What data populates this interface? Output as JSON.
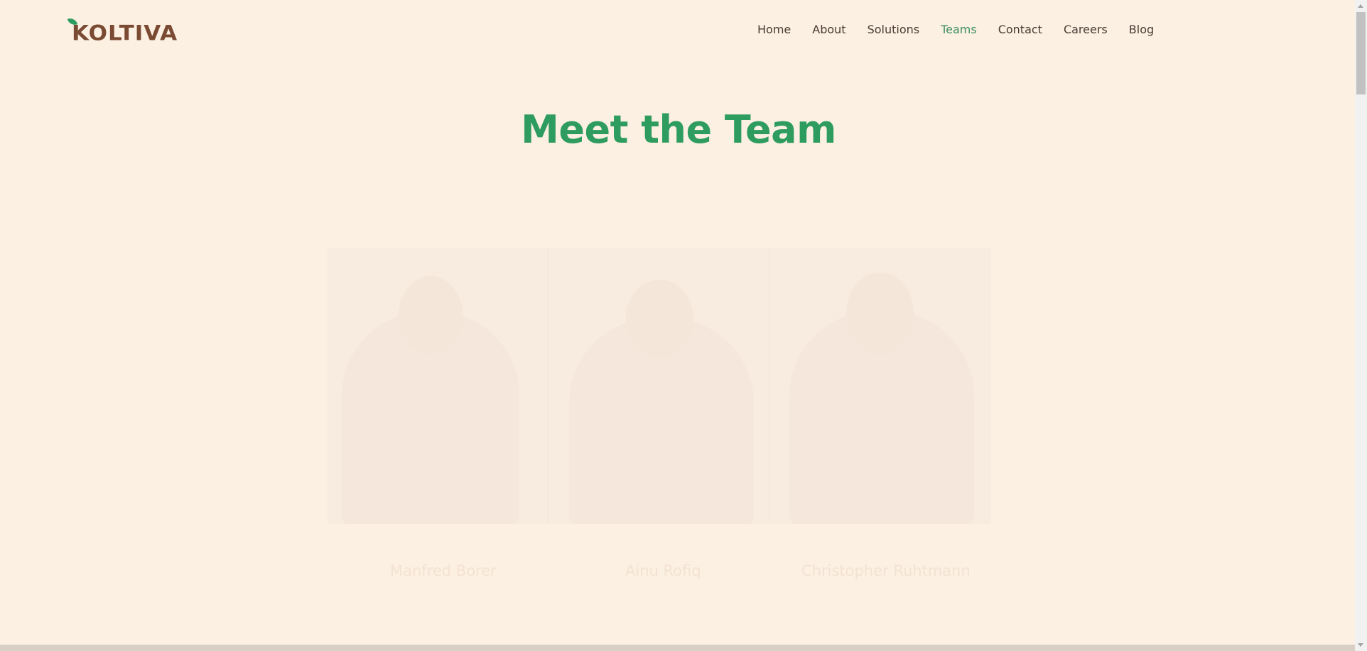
{
  "brand": {
    "name": "KOLTIVA",
    "leaf_color": "#2f9c5f",
    "text_color": "#7a4a33"
  },
  "nav": {
    "items": [
      {
        "label": "Home",
        "active": false
      },
      {
        "label": "About",
        "active": false
      },
      {
        "label": "Solutions",
        "active": false
      },
      {
        "label": "Teams",
        "active": true
      },
      {
        "label": "Contact",
        "active": false
      },
      {
        "label": "Careers",
        "active": false
      },
      {
        "label": "Blog",
        "active": false
      }
    ],
    "active_color": "#3f8f62"
  },
  "hero": {
    "title": "Meet the Team",
    "title_color": "#2f9c5f"
  },
  "team": {
    "members": [
      {
        "name": "Manfred Borer"
      },
      {
        "name": "Ainu Rofiq"
      },
      {
        "name": "Christopher Ruhtmann"
      }
    ]
  },
  "colors": {
    "background": "#fcf0e3"
  }
}
